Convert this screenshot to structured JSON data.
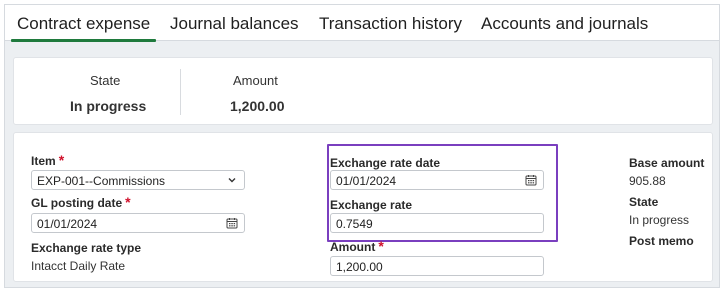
{
  "tabs": [
    "Contract expense",
    "Journal balances",
    "Transaction history",
    "Accounts and journals"
  ],
  "summary": {
    "state_label": "State",
    "state_value": "In progress",
    "amount_label": "Amount",
    "amount_value": "1,200.00"
  },
  "form": {
    "item_label": "Item",
    "item_value": "EXP-001--Commissions",
    "gl_posting_date_label": "GL posting date",
    "gl_posting_date_value": "01/01/2024",
    "exchange_rate_type_label": "Exchange rate type",
    "exchange_rate_type_value": "Intacct Daily Rate",
    "exchange_rate_date_label": "Exchange rate date",
    "exchange_rate_date_value": "01/01/2024",
    "exchange_rate_label": "Exchange rate",
    "exchange_rate_value": "0.7549",
    "amount_label": "Amount",
    "amount_value": "1,200.00",
    "base_amount_label": "Base amount",
    "base_amount_value": "905.88",
    "state_label": "State",
    "state_value": "In progress",
    "post_memo_label": "Post memo",
    "required_marker": "*"
  },
  "icons": {
    "dropdown": "chevron-down-icon",
    "calendar": "calendar-icon"
  },
  "colors": {
    "active_tab_underline": "#1f7a3d",
    "required": "#d0102b",
    "highlight_box": "#7a3fbf"
  }
}
